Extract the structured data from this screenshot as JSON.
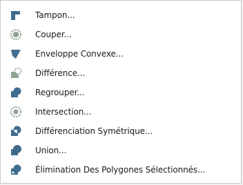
{
  "menu": {
    "items": [
      {
        "label": "Tampon...",
        "icon": "buffer-icon"
      },
      {
        "label": "Couper...",
        "icon": "clip-icon"
      },
      {
        "label": "Enveloppe Convexe...",
        "icon": "convex-hull-icon"
      },
      {
        "label": "Différence...",
        "icon": "difference-icon"
      },
      {
        "label": "Regrouper...",
        "icon": "dissolve-icon"
      },
      {
        "label": "Intersection...",
        "icon": "intersection-icon"
      },
      {
        "label": "Différenciation Symétrique...",
        "icon": "symmetric-difference-icon"
      },
      {
        "label": "Union...",
        "icon": "union-icon"
      },
      {
        "label": "Élimination Des Polygones Sélectionnés...",
        "icon": "eliminate-polygons-icon"
      }
    ]
  },
  "colors": {
    "icon_blue": "#3f6d8e",
    "icon_dotted": "#7c8f82"
  }
}
